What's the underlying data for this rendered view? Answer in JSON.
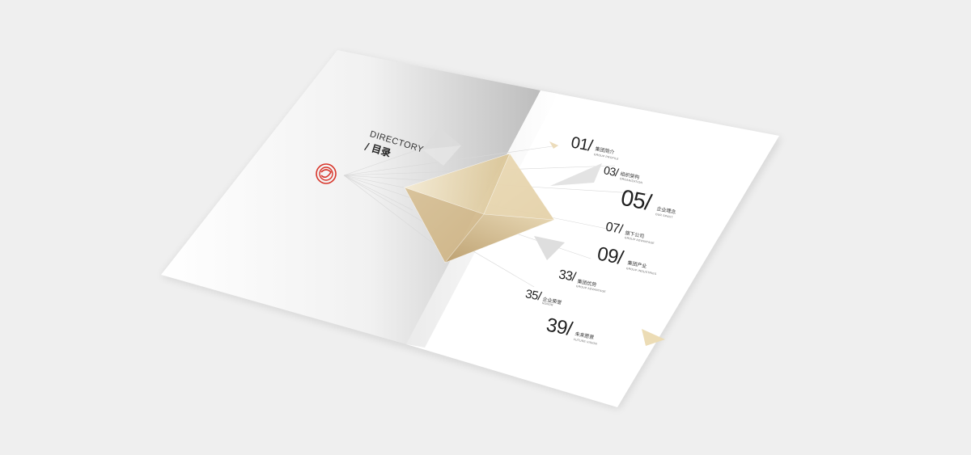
{
  "directory": {
    "title_en": "DIRECTORY",
    "title_cn": "/ 目录"
  },
  "colors": {
    "background": "#efefef",
    "page": "#ffffff",
    "gold": "#d9c49a",
    "logo_red": "#d8352a",
    "text": "#1e1e1e"
  },
  "icons": {
    "logo": "spiral-logo-icon"
  },
  "toc": [
    {
      "num": "01/",
      "cn": "集团简介",
      "en": "GROUP PROFILE"
    },
    {
      "num": "03/",
      "cn": "组织架构",
      "en": "ORGANIZATION"
    },
    {
      "num": "05/",
      "cn": "企业理念",
      "en": "OUR SPIRIT"
    },
    {
      "num": "07/",
      "cn": "旗下公司",
      "en": "GROUP ADVANTAGE"
    },
    {
      "num": "09/",
      "cn": "集团产业",
      "en": "GROUP INDUSTRIES"
    },
    {
      "num": "33/",
      "cn": "集团优势",
      "en": "GROUP ADVANTAGE"
    },
    {
      "num": "35/",
      "cn": "企业荣誉",
      "en": "HONOR"
    },
    {
      "num": "39/",
      "cn": "未来愿景",
      "en": "FUTURE VISION"
    }
  ]
}
